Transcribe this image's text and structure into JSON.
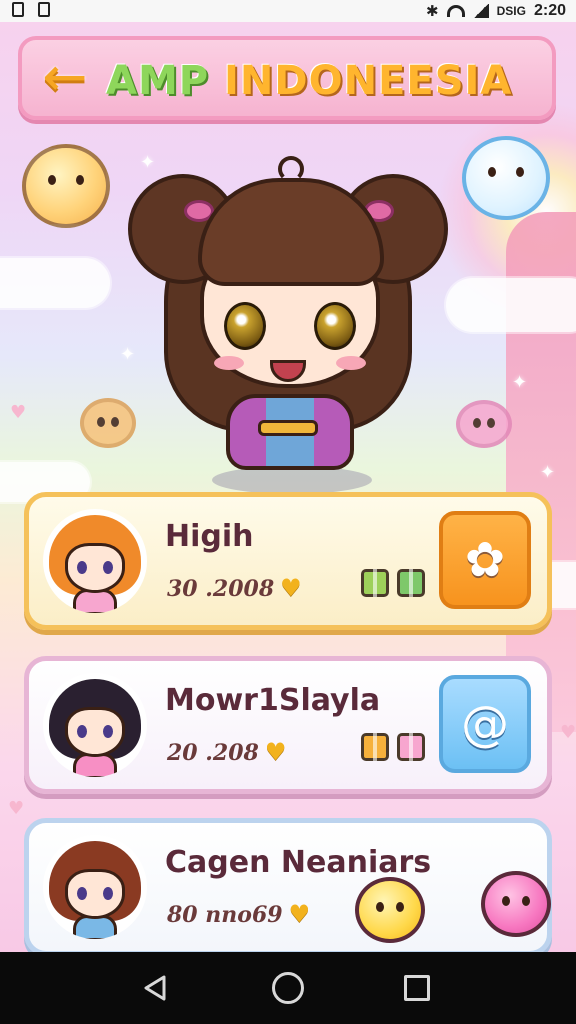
{
  "status_bar": {
    "time": "2:20",
    "carrier_text": "DSIG",
    "icons": [
      "image-icon",
      "sim-icon",
      "bluetooth-icon",
      "wifi-icon",
      "signal-icon"
    ]
  },
  "header": {
    "back_icon": "arrow-left-icon",
    "title_part1": "AMP",
    "title_part2": "INDONEESIA"
  },
  "players": [
    {
      "name": "Higih",
      "score": "30 .2008",
      "avatar_hair": "#f08a2a",
      "avatar_outfit": "#f7a6cf",
      "action_style": "orange",
      "action_icon": "cat-icon"
    },
    {
      "name": "Mowr1Slayla",
      "score": "20 .208",
      "avatar_hair": "#2a2030",
      "avatar_outfit": "#f78fc4",
      "action_style": "blue",
      "action_icon": "swirl-icon"
    },
    {
      "name": "Cagen Neaniars",
      "score": "80 nno69",
      "avatar_hair": "#8a3a22",
      "avatar_outfit": "#7ab8e6"
    }
  ],
  "colors": {
    "gold": "#f2b21d",
    "card1_border": "#f5c15a",
    "card2_border": "#e7b5d5",
    "card3_border": "#bcd3ee",
    "title_orange": "#ffb52e",
    "title_green": "#8ed65b"
  },
  "nav": {
    "back_icon": "nav-back-icon",
    "home_icon": "nav-home-icon",
    "recents_icon": "nav-recents-icon"
  }
}
